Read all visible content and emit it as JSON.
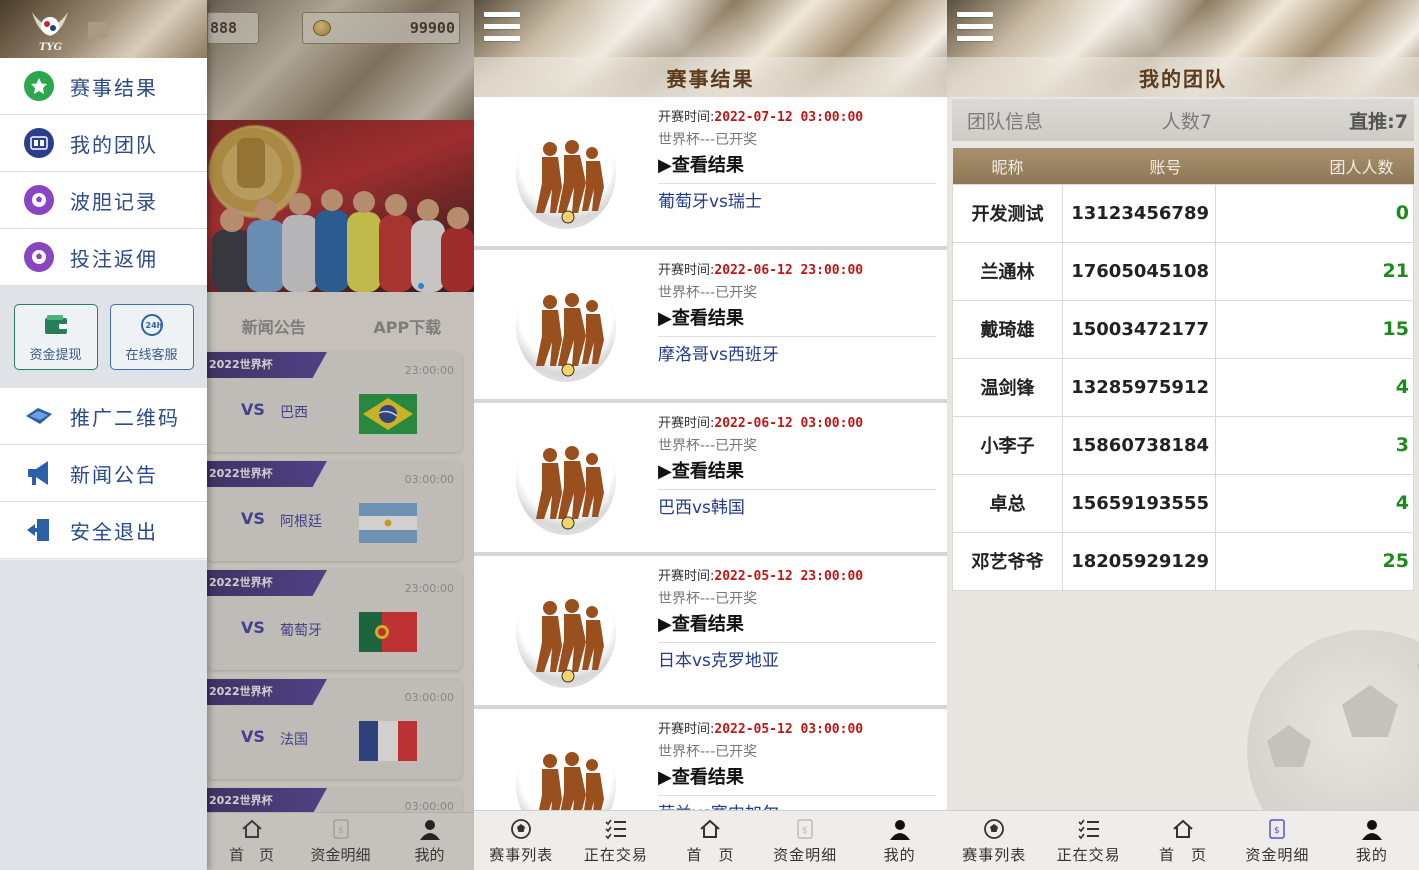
{
  "screen1": {
    "balance_left": "888",
    "balance_right": "99900",
    "drawer": {
      "menu": [
        {
          "label": "赛事结果",
          "icon": "star-icon",
          "color": "#2aa84a"
        },
        {
          "label": "我的团队",
          "icon": "team-icon",
          "color": "#2b3f88"
        },
        {
          "label": "波胆记录",
          "icon": "ball-record-icon",
          "color": "#8a46c2"
        },
        {
          "label": "投注返佣",
          "icon": "rebate-icon",
          "color": "#8a46c2"
        }
      ],
      "buttons": [
        {
          "label": "资金提现",
          "icon": "wallet-icon"
        },
        {
          "label": "在线客服",
          "icon": "service-24h-icon"
        }
      ],
      "menu2": [
        {
          "label": "推广二维码",
          "icon": "qrcode-icon"
        },
        {
          "label": "新闻公告",
          "icon": "megaphone-icon"
        },
        {
          "label": "安全退出",
          "icon": "exit-icon"
        }
      ]
    },
    "tabs": [
      "新闻公告",
      "APP下载"
    ],
    "matches": [
      {
        "tag": "2022世界杯",
        "time": "23:00:00",
        "vs": "VS",
        "team": "巴西",
        "flag": "brazil"
      },
      {
        "tag": "2022世界杯",
        "time": "03:00:00",
        "vs": "VS",
        "team": "阿根廷",
        "flag": "argentina"
      },
      {
        "tag": "2022世界杯",
        "time": "23:00:00",
        "vs": "VS",
        "team": "葡萄牙",
        "flag": "portugal"
      },
      {
        "tag": "2022世界杯",
        "time": "03:00:00",
        "vs": "VS",
        "team": "法国",
        "flag": "france"
      },
      {
        "tag": "2022世界杯",
        "time": "03:00:00",
        "vs": "",
        "team": "",
        "flag": ""
      }
    ],
    "bottom_nav": [
      {
        "label": "首　页",
        "icon": "home-icon"
      },
      {
        "label": "资金明细",
        "icon": "document-icon"
      },
      {
        "label": "我的",
        "icon": "user-icon"
      }
    ]
  },
  "screen2": {
    "title": "赛事结果",
    "start_label": "开赛时间:",
    "results": [
      {
        "time": "2022-07-12 03:00:00",
        "league": "世界杯---已开奖",
        "view": "▶查看结果",
        "match": "葡萄牙vs瑞士"
      },
      {
        "time": "2022-06-12 23:00:00",
        "league": "世界杯---已开奖",
        "view": "▶查看结果",
        "match": "摩洛哥vs西班牙"
      },
      {
        "time": "2022-06-12 03:00:00",
        "league": "世界杯---已开奖",
        "view": "▶查看结果",
        "match": "巴西vs韩国"
      },
      {
        "time": "2022-05-12 23:00:00",
        "league": "世界杯---已开奖",
        "view": "▶查看结果",
        "match": "日本vs克罗地亚"
      },
      {
        "time": "2022-05-12 03:00:00",
        "league": "世界杯---已开奖",
        "view": "▶查看结果",
        "match": "荷兰vs塞内加尔"
      }
    ]
  },
  "screen3": {
    "title": "我的团队",
    "info": {
      "label": "团队信息",
      "count": "人数7",
      "direct": "直推:7"
    },
    "headers": [
      "昵称",
      "账号",
      "团人人数"
    ],
    "rows": [
      {
        "name": "开发测试",
        "account": "13123456789",
        "count": "0"
      },
      {
        "name": "兰通林",
        "account": "17605045108",
        "count": "21"
      },
      {
        "name": "戴琦雄",
        "account": "15003472177",
        "count": "15"
      },
      {
        "name": "温剑锋",
        "account": "13285975912",
        "count": "4"
      },
      {
        "name": "小李子",
        "account": "15860738184",
        "count": "3"
      },
      {
        "name": "卓总",
        "account": "15659193555",
        "count": "4"
      },
      {
        "name": "邓艺爷爷",
        "account": "18205929129",
        "count": "25"
      }
    ]
  },
  "bottom_nav_full": [
    {
      "label": "赛事列表",
      "icon": "soccer-ball-icon"
    },
    {
      "label": "正在交易",
      "icon": "list-icon"
    },
    {
      "label": "首　页",
      "icon": "home-icon"
    },
    {
      "label": "资金明细",
      "icon": "document-icon"
    },
    {
      "label": "我的",
      "icon": "user-icon"
    }
  ]
}
